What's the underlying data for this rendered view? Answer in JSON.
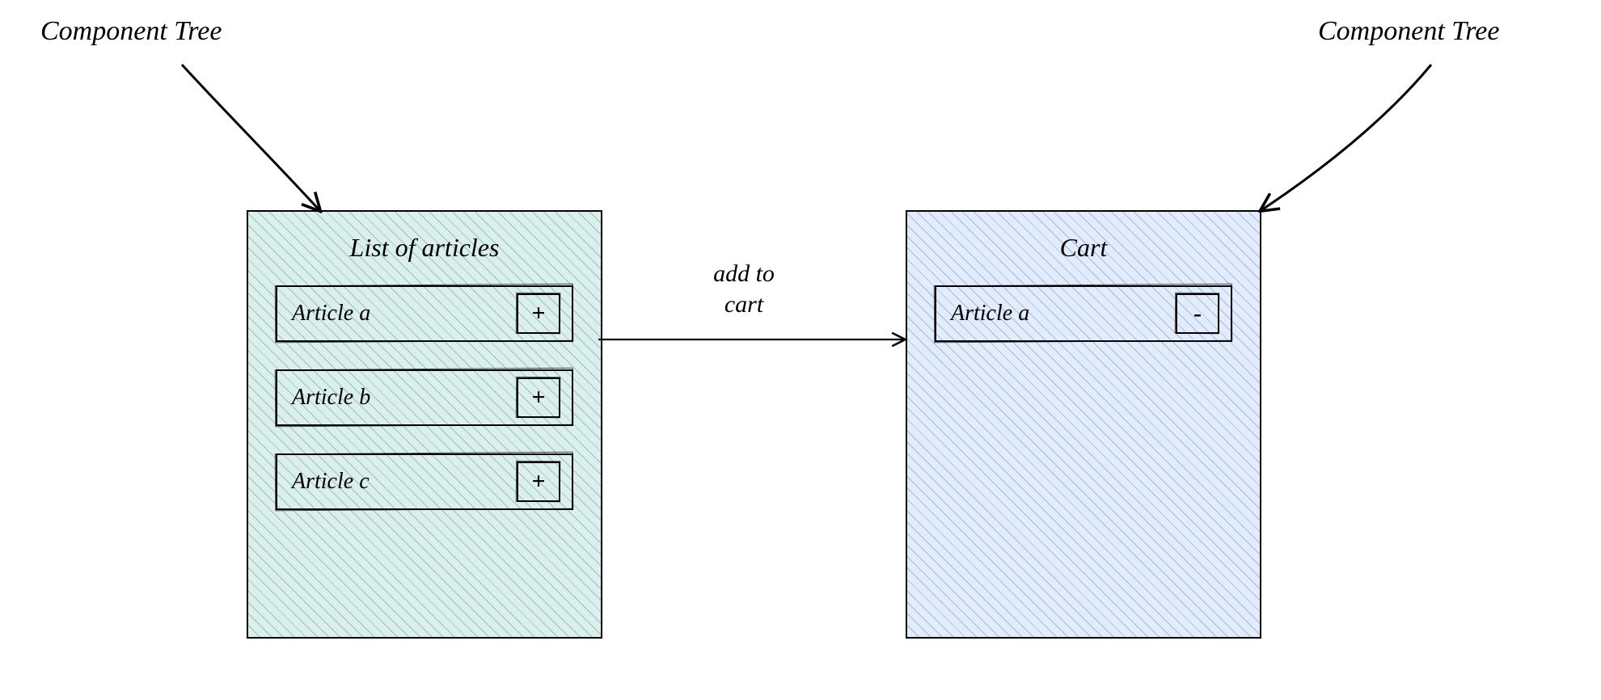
{
  "labels": {
    "left_tree": "Component Tree",
    "right_tree": "Component Tree",
    "add_to_cart_line1": "add to",
    "add_to_cart_line2": "cart"
  },
  "panels": {
    "articles": {
      "title": "List of articles",
      "items": [
        {
          "label": "Article a",
          "btn": "+"
        },
        {
          "label": "Article b",
          "btn": "+"
        },
        {
          "label": "Article c",
          "btn": "+"
        }
      ]
    },
    "cart": {
      "title": "Cart",
      "items": [
        {
          "label": "Article a",
          "btn": "-"
        }
      ]
    }
  },
  "colors": {
    "teal": "#8fd3cc",
    "blue": "#9fb8ff",
    "ink": "#000000"
  }
}
